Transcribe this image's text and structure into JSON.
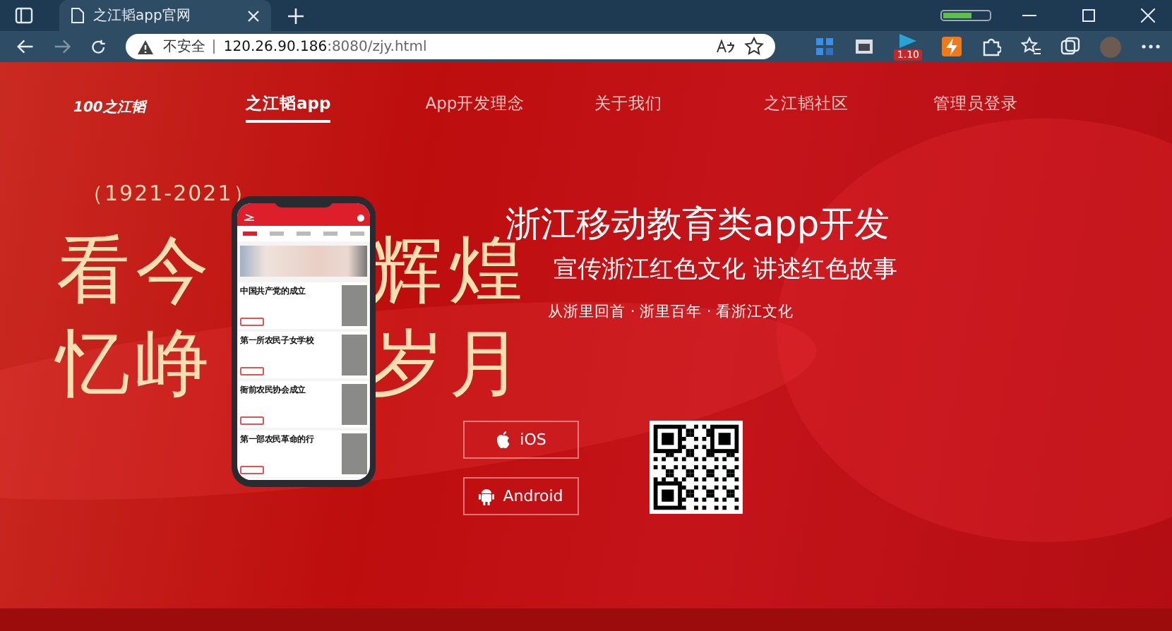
{
  "browser": {
    "tab_title": "之江韬app官网",
    "security": "不安全",
    "url_host": "120.26.90.186",
    "url_rest": ":8080/zjy.html",
    "extension_badge": "1.10"
  },
  "nav": {
    "logo": "100之江韬",
    "items": [
      {
        "label": "之江韬app",
        "selected": true
      },
      {
        "label": "App开发理念",
        "selected": false
      },
      {
        "label": "关于我们",
        "selected": false
      },
      {
        "label": "之江韬社区",
        "selected": false
      },
      {
        "label": "管理员登录",
        "selected": false
      }
    ]
  },
  "hero": {
    "years": "（1921-2021）",
    "line1_left": "看今",
    "line1_right": "辉煌",
    "line2_left": "忆峥",
    "line2_right": "岁月",
    "title": "浙江移动教育类app开发",
    "subtitle": "宣传浙江红色文化 讲述红色故事",
    "tagline": "从浙里回首 · 浙里百年 · 看浙江文化",
    "downloads": [
      {
        "kind": "ios",
        "label": "iOS"
      },
      {
        "kind": "android",
        "label": "Android"
      }
    ]
  },
  "phone": {
    "tabs": [
      {
        "selected": true
      },
      {
        "selected": false
      },
      {
        "selected": false
      },
      {
        "selected": false
      },
      {
        "selected": false
      }
    ],
    "news": [
      {
        "title": "中国共产党的成立"
      },
      {
        "title": "第一所农民子女学校"
      },
      {
        "title": "衙前农民协会成立"
      },
      {
        "title": "第一部农民革命的行"
      }
    ]
  }
}
